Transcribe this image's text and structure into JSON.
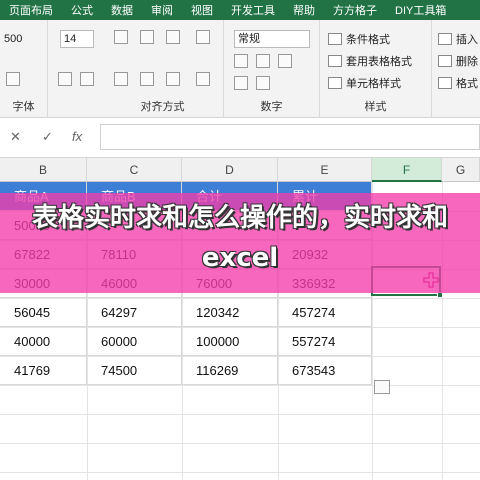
{
  "menu": {
    "tabs": [
      "页面布局",
      "公式",
      "数据",
      "审阅",
      "视图",
      "开发工具",
      "帮助",
      "方方格子",
      "DIY工具箱"
    ]
  },
  "ribbon": {
    "font_size": "14",
    "number_format": "常规",
    "font_group_label": "字体",
    "align_group_label": "对齐方式",
    "number_group_label": "数字",
    "style_group_label": "样式",
    "conditional_format": "条件格式",
    "table_format": "套用表格格式",
    "cell_style": "单元格样式",
    "insert": "插入",
    "delete": "删除",
    "format": "格式"
  },
  "formula_bar": {
    "cancel": "✕",
    "confirm": "✓",
    "fx": "fx"
  },
  "columns": [
    "B",
    "C",
    "D",
    "E",
    "F",
    "G"
  ],
  "table": {
    "headers": [
      "商品A",
      "商品B",
      "合计",
      "累计"
    ],
    "rows": [
      [
        "50000",
        "",
        "",
        ""
      ],
      [
        "67822",
        "78110",
        "",
        "20932"
      ],
      [
        "30000",
        "46000",
        "76000",
        "336932"
      ],
      [
        "56045",
        "64297",
        "120342",
        "457274"
      ],
      [
        "40000",
        "60000",
        "100000",
        "557274"
      ],
      [
        "41769",
        "74500",
        "116269",
        "673543"
      ]
    ]
  },
  "banner": {
    "title": "表格实时求和怎么操作的，实时求和excel"
  },
  "colors": {
    "excel_green": "#217346",
    "header_blue": "#3d7fd6",
    "banner_pink": "#f43caa"
  }
}
